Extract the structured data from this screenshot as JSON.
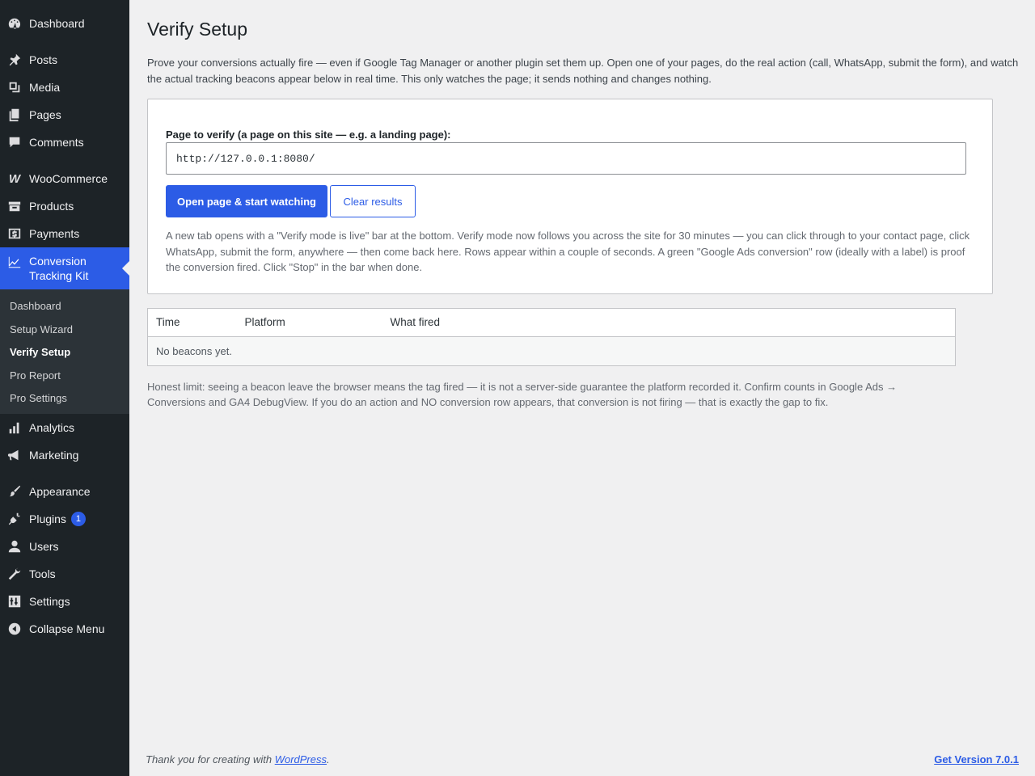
{
  "sidebar": {
    "dashboard": "Dashboard",
    "posts": "Posts",
    "media": "Media",
    "pages": "Pages",
    "comments": "Comments",
    "woocommerce": "WooCommerce",
    "products": "Products",
    "payments": "Payments",
    "conversion": "Conversion Tracking Kit",
    "submenu": [
      "Dashboard",
      "Setup Wizard",
      "Verify Setup",
      "Pro Report",
      "Pro Settings"
    ],
    "analytics": "Analytics",
    "marketing": "Marketing",
    "appearance": "Appearance",
    "plugins": "Plugins",
    "plugins_badge": "1",
    "users": "Users",
    "tools": "Tools",
    "settings": "Settings",
    "collapse": "Collapse Menu"
  },
  "page": {
    "title": "Verify Setup",
    "intro": "Prove your conversions actually fire — even if Google Tag Manager or another plugin set them up. Open one of your pages, do the real action (call, WhatsApp, submit the form), and watch the actual tracking beacons appear below in real time. This only watches the page; it sends nothing and changes nothing.",
    "url_label": "Page to verify (a page on this site — e.g. a landing page):",
    "url_value": "http://127.0.0.1:8080/",
    "start_button": "Open page & start watching",
    "clear_button": "Clear results",
    "help_text": "A new tab opens with a \"Verify mode is live\" bar at the bottom. Verify mode now follows you across the site for 30 minutes — you can click through to your contact page, click WhatsApp, submit the form, anywhere — then come back here. Rows appear within a couple of seconds. A green \"Google Ads conversion\" row (ideally with a label) is proof the conversion fired. Click \"Stop\" in the bar when done.",
    "table": {
      "headers": [
        "Time",
        "Platform",
        "What fired"
      ],
      "empty": "No beacons yet."
    },
    "honest_limit": "Honest limit: seeing a beacon leave the browser means the tag fired — it is not a server-side guarantee the platform recorded it. Confirm counts in Google Ads → Conversions and GA4 DebugView. If you do an action and NO conversion row appears, that conversion is not firing — that is exactly the gap to fix."
  },
  "footer": {
    "thanks_prefix": "Thank you for creating with ",
    "thanks_link": "WordPress",
    "thanks_suffix": ".",
    "version": "Get Version 7.0.1"
  },
  "colors": {
    "accent": "#2c5ce6",
    "sidebar_bg": "#1d2327",
    "submenu_bg": "#2c3338",
    "page_bg": "#f0f0f1"
  }
}
